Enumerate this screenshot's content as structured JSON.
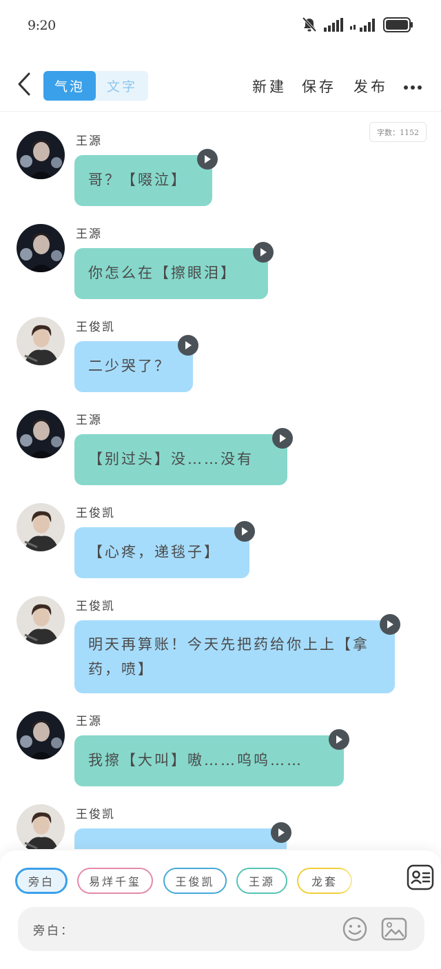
{
  "status_bar": {
    "time": "9:20",
    "icons": [
      "bell-muted-icon",
      "signal-icon",
      "signal-icon",
      "battery-icon"
    ]
  },
  "header": {
    "back_icon": "chevron-left-icon",
    "tabs": [
      {
        "label": "气泡",
        "active": true
      },
      {
        "label": "文字",
        "active": false
      }
    ],
    "actions": [
      "新建",
      "保存",
      "发布"
    ],
    "more_icon": "more-horizontal-icon"
  },
  "word_count": "字数：1152",
  "messages": [
    {
      "sender": "王源",
      "text": "哥？【啜泣】",
      "color": "green"
    },
    {
      "sender": "王源",
      "text": "你怎么在【擦眼泪】",
      "color": "green"
    },
    {
      "sender": "王俊凯",
      "text": "二少哭了？",
      "color": "blue"
    },
    {
      "sender": "王源",
      "text": "【别过头】没……没有",
      "color": "green"
    },
    {
      "sender": "王俊凯",
      "text": "【心疼，递毯子】",
      "color": "blue"
    },
    {
      "sender": "王俊凯",
      "text": "明天再算账！今天先把药给你上上【拿药，喷】",
      "color": "blue"
    },
    {
      "sender": "王源",
      "text": "我擦【大叫】嗷……呜呜……",
      "color": "green"
    },
    {
      "sender": "王俊凯",
      "text": "",
      "color": "blue"
    }
  ],
  "colors": {
    "green_bubble": "#87d8cb",
    "blue_bubble": "#a6dcfb",
    "accent": "#3aa0ea"
  },
  "characters": [
    {
      "label": "旁白",
      "border": "#3aa0ea"
    },
    {
      "label": "易烊千玺",
      "border": "#e48aa8"
    },
    {
      "label": "王俊凯",
      "border": "#45a9d8"
    },
    {
      "label": "王源",
      "border": "#55c3b4"
    },
    {
      "label": "龙套",
      "border": "#f0cf3a"
    }
  ],
  "input": {
    "label": "旁白："
  }
}
